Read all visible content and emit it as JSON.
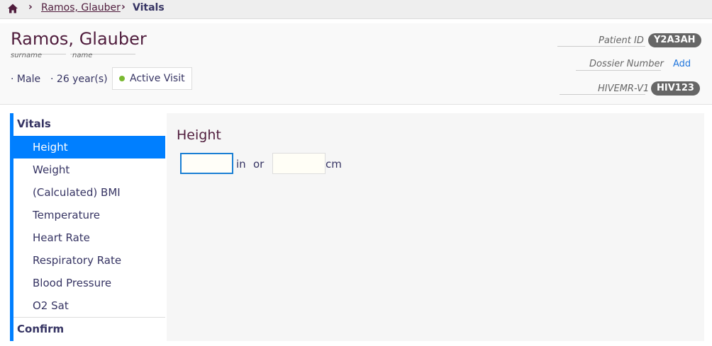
{
  "breadcrumb": {
    "home_icon": "home-icon",
    "patient_link": "Ramos, Glauber",
    "current": "Vitals"
  },
  "patient": {
    "surname": "Ramos,",
    "given_name": "Glauber",
    "surname_label": "surname",
    "name_label": "name",
    "gender": "Male",
    "age": "26 year(s)",
    "visit_status": "Active Visit",
    "visit_color": "#7ab931",
    "identifiers": [
      {
        "label": "Patient ID",
        "value": "Y2A3AH"
      },
      {
        "label": "Dossier Number",
        "action": "Add"
      },
      {
        "label": "HIVEMR-V1",
        "value": "HIV123"
      }
    ]
  },
  "nav": {
    "section_title": "Vitals",
    "items": [
      "Height",
      "Weight",
      "(Calculated) BMI",
      "Temperature",
      "Heart Rate",
      "Respiratory Rate",
      "Blood Pressure",
      "O2 Sat"
    ],
    "active_index": 0,
    "confirm_label": "Confirm"
  },
  "form": {
    "question": "Height",
    "inches_value": "",
    "inches_unit": "in",
    "or_text": "or",
    "cm_value": "",
    "cm_unit": "cm"
  },
  "colors": {
    "accent": "#007fff",
    "brand": "#501d3d",
    "text": "#363463"
  }
}
